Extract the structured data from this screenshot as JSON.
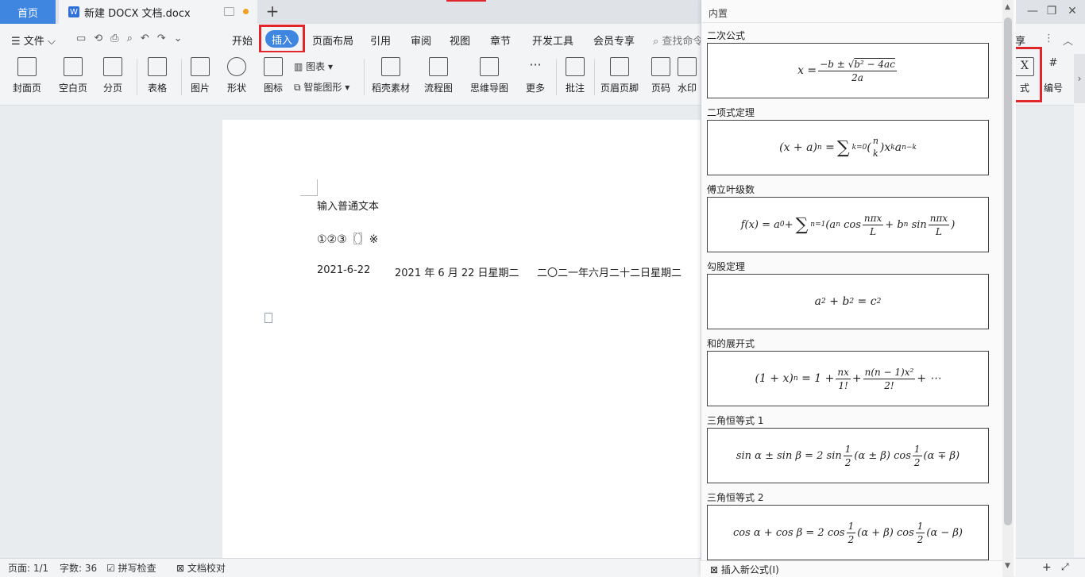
{
  "tabs": {
    "home": "首页",
    "doc": "新建 DOCX 文档.docx",
    "add": "+"
  },
  "menu": {
    "file": "文件",
    "items": [
      "开始",
      "插入",
      "页面布局",
      "引用",
      "审阅",
      "视图",
      "章节",
      "开发工具",
      "会员专享"
    ],
    "search": "查找命令",
    "share_partial": "享"
  },
  "ribbon": {
    "cover": "封面页",
    "blank": "空白页",
    "pagebreak": "分页",
    "table": "表格",
    "picture": "图片",
    "shape": "形状",
    "icon": "图标",
    "chart": "图表",
    "smartart": "智能图形",
    "dochome": "稻壳素材",
    "flow": "流程图",
    "mindmap": "思维导图",
    "more": "更多",
    "comment": "批注",
    "header": "页眉页脚",
    "pageno": "页码",
    "watermark": "水印",
    "formula_partial": "式",
    "numbering": "编号"
  },
  "document": {
    "line1": "输入普通文本",
    "line2": "①②③〖〗※",
    "date1": "2021-6-22",
    "date2": "2021 年 6 月 22 日星期二",
    "date3": "二〇二一年六月二十二日星期二"
  },
  "status": {
    "page": "页面: 1/1",
    "words": "字数: 36",
    "spell": "拼写检查",
    "proof": "文档校对"
  },
  "panel": {
    "header": "内置",
    "sections": [
      "二次公式",
      "二项式定理",
      "傅立叶级数",
      "勾股定理",
      "和的展开式",
      "三角恒等式 1",
      "三角恒等式 2"
    ],
    "insert_new": "插入新公式(I)"
  }
}
